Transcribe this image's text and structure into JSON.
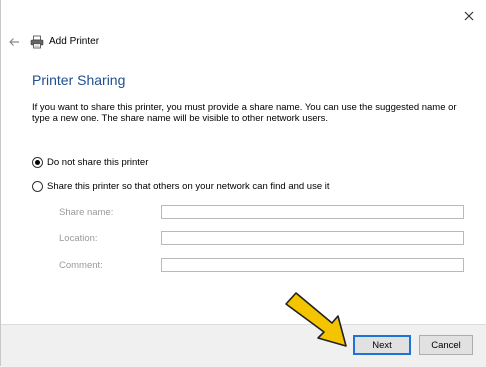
{
  "window": {
    "close_glyph": "×",
    "back_icon": "back-arrow-icon",
    "printer_icon": "printer-icon",
    "header_title": "Add Printer"
  },
  "page": {
    "title": "Printer Sharing",
    "description": "If you want to share this printer, you must provide a share name. You can use the suggested name or type a new one. The share name will be visible to other network users."
  },
  "options": [
    {
      "label": "Do not share this printer",
      "selected": true
    },
    {
      "label": "Share this printer so that others on your network can find and use it",
      "selected": false
    }
  ],
  "fields": [
    {
      "label": "Share name:",
      "value": ""
    },
    {
      "label": "Location:",
      "value": ""
    },
    {
      "label": "Comment:",
      "value": ""
    }
  ],
  "buttons": {
    "next": "Next",
    "cancel": "Cancel"
  },
  "colors": {
    "title_blue": "#1e4f8f",
    "focus_blue": "#1e73d8",
    "arrow_fill": "#f5c400"
  }
}
